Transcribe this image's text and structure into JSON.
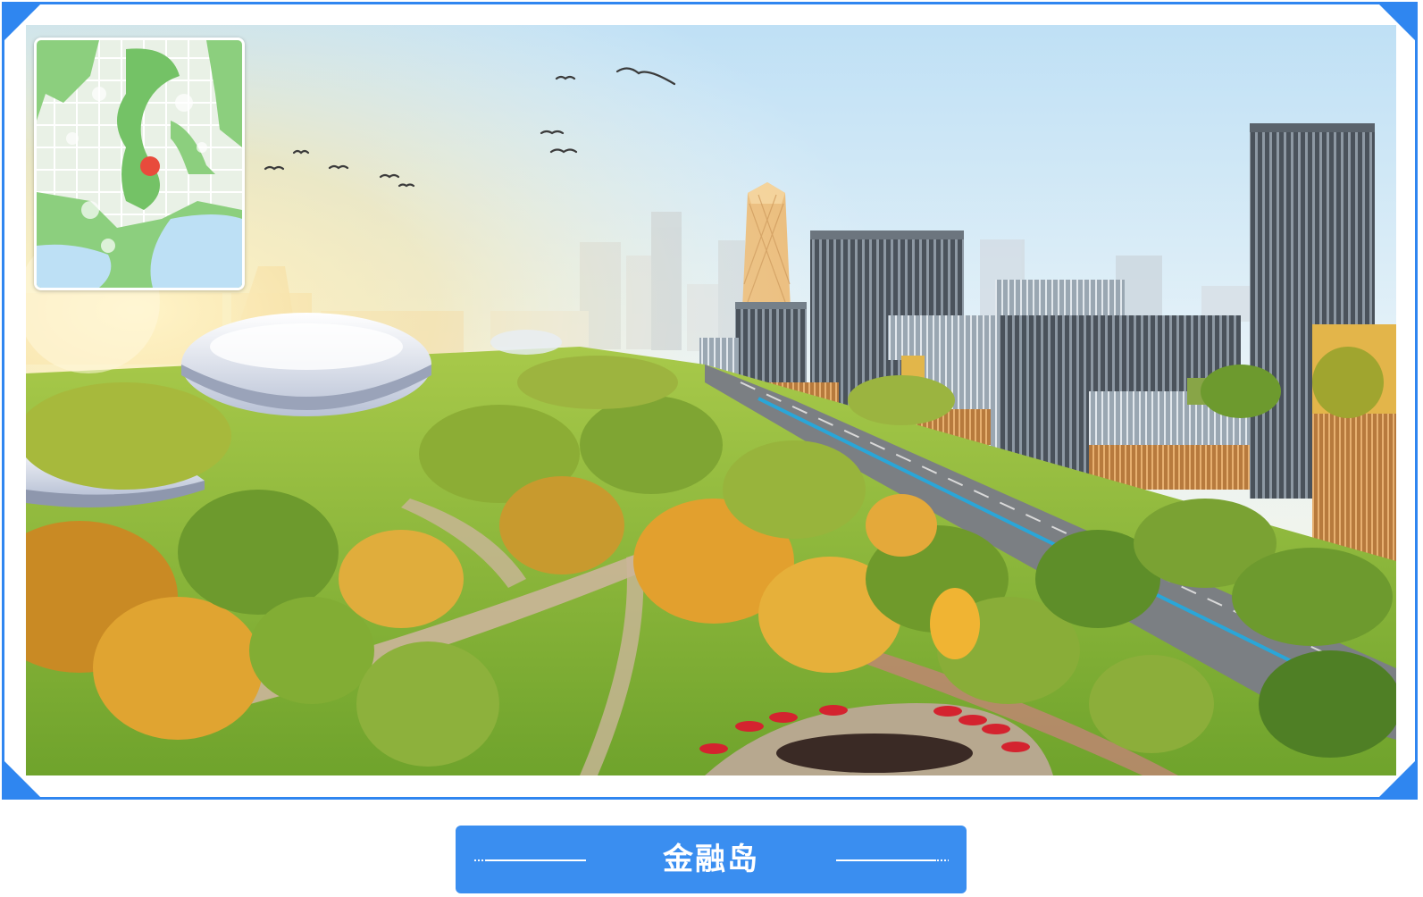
{
  "caption": {
    "title": "金融岛"
  },
  "scene": {
    "image_subject": "urban-park-rendering",
    "sky_top": "#bfe0f5",
    "sky_bottom": "#fff6dc",
    "accent": "#2f86f0"
  },
  "minimap": {
    "marker_color": "#e84b3c",
    "land_color": "#8ccf7e",
    "water_color": "#bde0f5"
  }
}
